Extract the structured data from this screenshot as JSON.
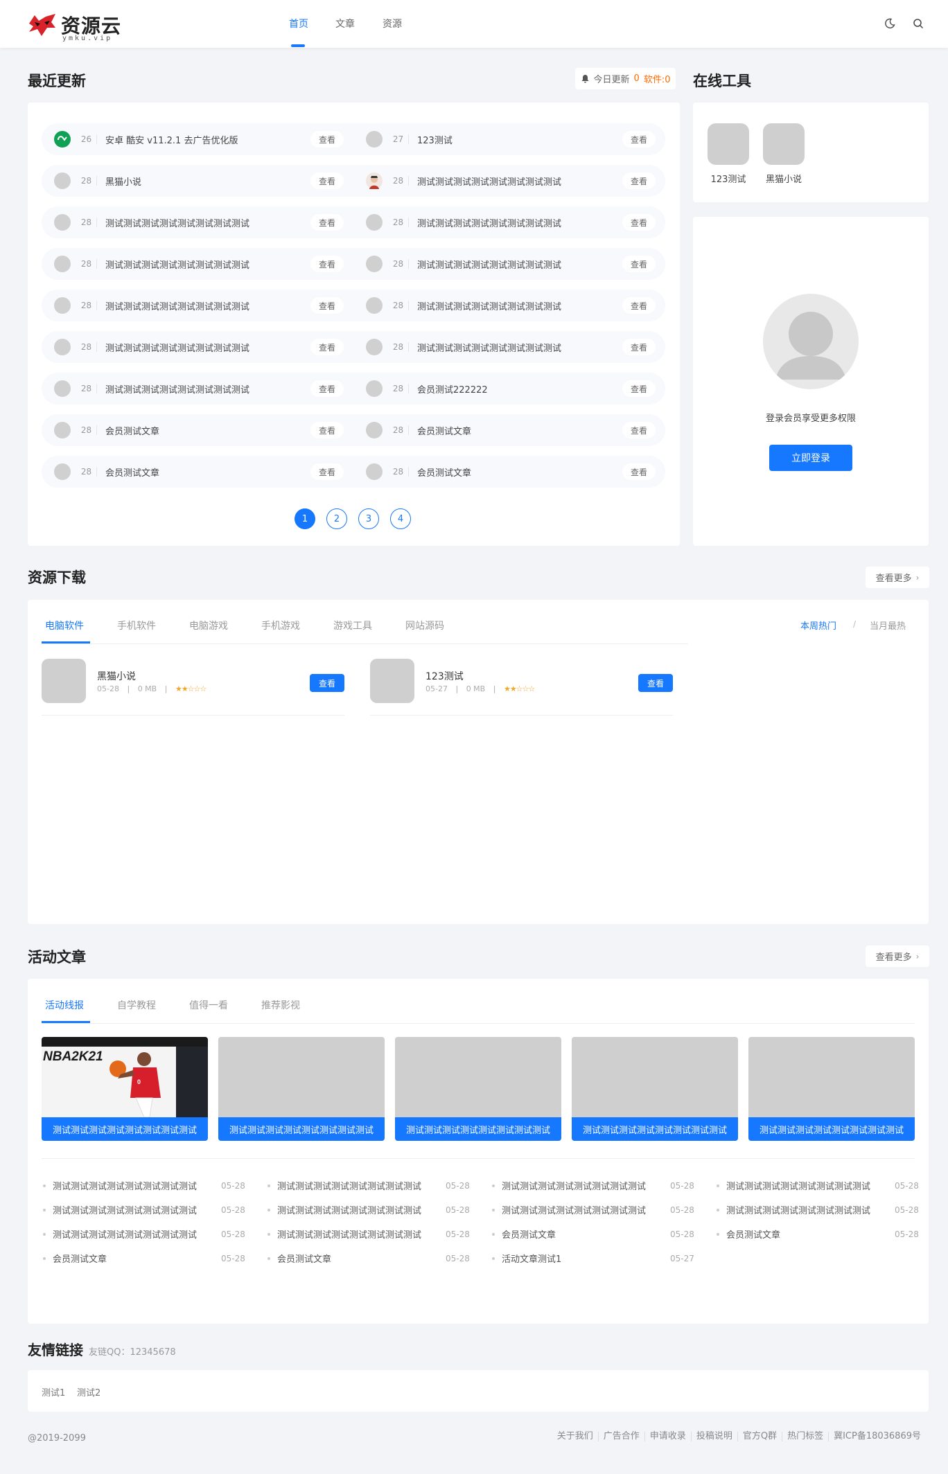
{
  "header": {
    "logo_text": "资源云",
    "logo_sub": "ymku.vip",
    "nav": [
      "首页",
      "文章",
      "资源"
    ],
    "brand_color": "#1677ff"
  },
  "recent": {
    "title": "最近更新",
    "today_label": "今日更新",
    "today_count": "0",
    "software_label": "软件:0",
    "view_label": "查看",
    "items": [
      {
        "num": "26",
        "title": "安卓 酷安 v11.2.1 去广告优化版",
        "icon": "coolapk-icon"
      },
      {
        "num": "27",
        "title": "123测试",
        "icon": "placeholder"
      },
      {
        "num": "28",
        "title": "黑猫小说",
        "icon": "placeholder"
      },
      {
        "num": "28",
        "title": "测试测试测试测试测试测试测试测试",
        "icon": "avatar-icon"
      },
      {
        "num": "28",
        "title": "测试测试测试测试测试测试测试测试",
        "icon": "placeholder"
      },
      {
        "num": "28",
        "title": "测试测试测试测试测试测试测试测试",
        "icon": "placeholder"
      },
      {
        "num": "28",
        "title": "测试测试测试测试测试测试测试测试",
        "icon": "placeholder"
      },
      {
        "num": "28",
        "title": "测试测试测试测试测试测试测试测试",
        "icon": "placeholder"
      },
      {
        "num": "28",
        "title": "测试测试测试测试测试测试测试测试",
        "icon": "placeholder"
      },
      {
        "num": "28",
        "title": "测试测试测试测试测试测试测试测试",
        "icon": "placeholder"
      },
      {
        "num": "28",
        "title": "测试测试测试测试测试测试测试测试",
        "icon": "placeholder"
      },
      {
        "num": "28",
        "title": "测试测试测试测试测试测试测试测试",
        "icon": "placeholder"
      },
      {
        "num": "28",
        "title": "测试测试测试测试测试测试测试测试",
        "icon": "placeholder"
      },
      {
        "num": "28",
        "title": "会员测试222222",
        "icon": "placeholder"
      },
      {
        "num": "28",
        "title": "会员测试文章",
        "icon": "placeholder"
      },
      {
        "num": "28",
        "title": "会员测试文章",
        "icon": "placeholder"
      },
      {
        "num": "28",
        "title": "会员测试文章",
        "icon": "placeholder"
      },
      {
        "num": "28",
        "title": "会员测试文章",
        "icon": "placeholder"
      }
    ],
    "pages": [
      "1",
      "2",
      "3",
      "4"
    ],
    "current_page": "1"
  },
  "tools": {
    "title": "在线工具",
    "items": [
      "123测试",
      "黑猫小说"
    ]
  },
  "login": {
    "text": "登录会员享受更多权限",
    "button": "立即登录"
  },
  "resources": {
    "title": "资源下载",
    "more": "查看更多",
    "tabs": [
      "电脑软件",
      "手机软件",
      "电脑游戏",
      "手机游戏",
      "游戏工具",
      "网站源码"
    ],
    "hot_tabs": [
      "本周热门",
      "当月最热"
    ],
    "hot_sep": "/",
    "view_label": "查看",
    "items": [
      {
        "name": "黑猫小说",
        "date": "05-28",
        "size": "0 MB",
        "stars": "★★☆☆☆"
      },
      {
        "name": "123测试",
        "date": "05-27",
        "size": "0 MB",
        "stars": "★★☆☆☆"
      }
    ]
  },
  "articles": {
    "title": "活动文章",
    "more": "查看更多",
    "tabs": [
      "活动线报",
      "自学教程",
      "值得一看",
      "推荐影视"
    ],
    "thumb_caption": "测试测试测试测试测试测试测试测试",
    "thumb_image_text": "NBA2K21",
    "list": [
      [
        {
          "t": "测试测试测试测试测试测试测试测试",
          "d": "05-28"
        },
        {
          "t": "测试测试测试测试测试测试测试测试",
          "d": "05-28"
        },
        {
          "t": "测试测试测试测试测试测试测试测试",
          "d": "05-28"
        },
        {
          "t": "会员测试文章",
          "d": "05-28"
        }
      ],
      [
        {
          "t": "测试测试测试测试测试测试测试测试",
          "d": "05-28"
        },
        {
          "t": "测试测试测试测试测试测试测试测试",
          "d": "05-28"
        },
        {
          "t": "测试测试测试测试测试测试测试测试",
          "d": "05-28"
        },
        {
          "t": "会员测试文章",
          "d": "05-28"
        }
      ],
      [
        {
          "t": "测试测试测试测试测试测试测试测试",
          "d": "05-28"
        },
        {
          "t": "测试测试测试测试测试测试测试测试",
          "d": "05-28"
        },
        {
          "t": "会员测试文章",
          "d": "05-28"
        },
        {
          "t": "活动文章测试1",
          "d": "05-27"
        }
      ],
      [
        {
          "t": "测试测试测试测试测试测试测试测试",
          "d": "05-28"
        },
        {
          "t": "测试测试测试测试测试测试测试测试",
          "d": "05-28"
        },
        {
          "t": "会员测试文章",
          "d": "05-28"
        }
      ]
    ]
  },
  "links": {
    "title": "友情链接",
    "qq": "友链QQ：12345678",
    "items": [
      "测试1",
      "测试2"
    ]
  },
  "footer": {
    "copyright": "@2019-2099",
    "links": [
      "关于我们",
      "广告合作",
      "申请收录",
      "投稿说明",
      "官方Q群",
      "热门标签",
      "冀ICP备18036869号"
    ]
  }
}
